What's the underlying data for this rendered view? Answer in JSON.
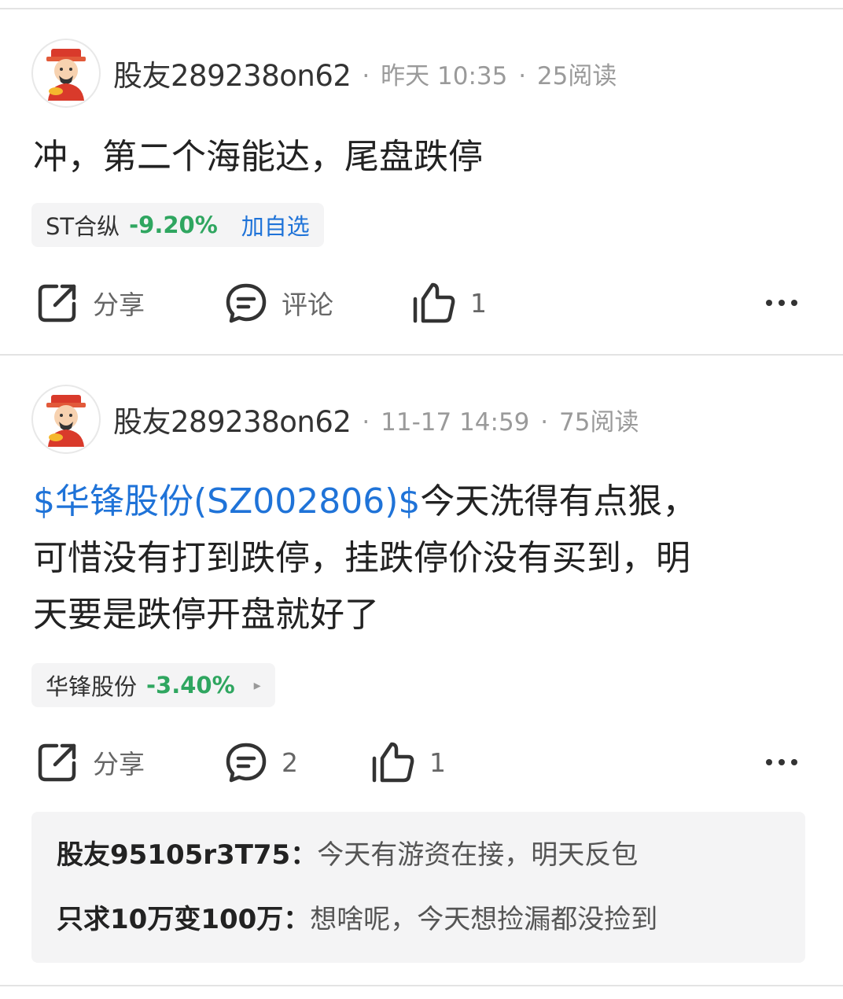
{
  "posts": [
    {
      "username": "股友289238on62",
      "time": "昨天 10:35",
      "reads": "25阅读",
      "content_lines": [
        "冲，第二个海能达，尾盘跌停"
      ],
      "stock": {
        "name": "ST合纵",
        "change": "-9.20%",
        "action": "加自选"
      },
      "actions": {
        "share": "分享",
        "comment": "评论",
        "like_count": "1"
      }
    },
    {
      "username": "股友289238on62",
      "time": "11-17 14:59",
      "reads": "75阅读",
      "content_link": "$华锋股份(SZ002806)$",
      "content_line1_rest": "今天洗得有点狠，",
      "content_line2": "可惜没有打到跌停，挂跌停价没有买到，明",
      "content_line3": "天要是跌停开盘就好了",
      "stock": {
        "name": "华锋股份",
        "change": "-3.40%",
        "arrow": "▸"
      },
      "actions": {
        "share": "分享",
        "comment_count": "2",
        "like_count": "1"
      },
      "comments": [
        {
          "author": "股友95105r3T75：",
          "text": "今天有游资在接，明天反包"
        },
        {
          "author": "只求10万变100万：",
          "text": "想啥呢，今天想捡漏都没捡到"
        }
      ]
    }
  ],
  "separator": "·",
  "colors": {
    "link": "#1f73d8",
    "down": "#2fa660",
    "meta": "#9a9a9a"
  },
  "icons": [
    "avatar-fortune-god",
    "share-icon",
    "comment-icon",
    "like-icon",
    "more-icon"
  ]
}
